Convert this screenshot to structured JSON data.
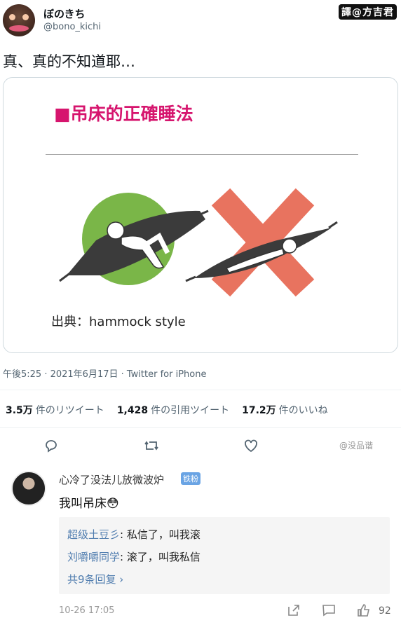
{
  "tweet": {
    "display_name": "ぼのきち",
    "handle": "@bono_kichi",
    "text": "真、真的不知道耶…",
    "meta": "午後5:25 · 2021年6月17日 · Twitter for iPhone",
    "translator_credit": "譯@方吉君",
    "card": {
      "title": "■吊床的正確睡法",
      "source": "出典：hammock style"
    },
    "stats": [
      {
        "value": "3.5万",
        "label": "件のリツイート"
      },
      {
        "value": "1,428",
        "label": "件の引用ツイート"
      },
      {
        "value": "17.2万",
        "label": "件のいいね"
      }
    ],
    "actions": [
      "reply-icon",
      "retweet-icon",
      "like-icon"
    ],
    "weibo_watermark": "@没品谐"
  },
  "comment": {
    "user": "心冷了没法儿放微波炉",
    "badge": "铁粉",
    "text": "我叫吊床😳",
    "replies": [
      {
        "user": "超级土豆彡",
        "text": ": 私信了，叫我滚"
      },
      {
        "user": "刘嚼嚼同学",
        "text": ": 滚了，叫我私信"
      }
    ],
    "more": "共9条回复 ›",
    "time": "10-26 17:05",
    "likes": "92"
  },
  "colors": {
    "title": "#d6156e",
    "link": "#507daf",
    "ok_circle": "#7ab648",
    "ng_cross": "#e8735f"
  }
}
